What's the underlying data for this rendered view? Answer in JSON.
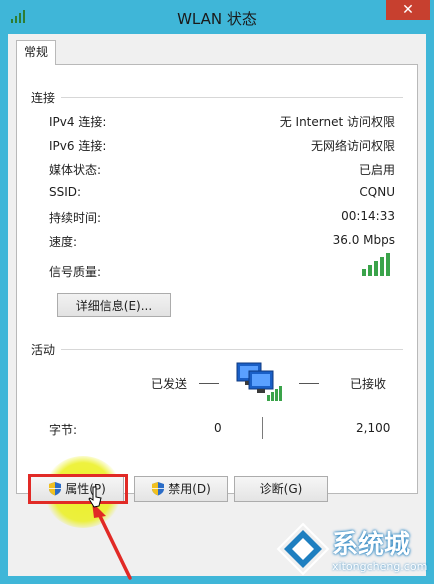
{
  "window": {
    "title": "WLAN 状态",
    "close_glyph": "✕"
  },
  "tabs": [
    {
      "label": "常规"
    }
  ],
  "connection": {
    "group_title": "连接",
    "rows": [
      {
        "label": "IPv4 连接:",
        "value": "无 Internet 访问权限"
      },
      {
        "label": "IPv6 连接:",
        "value": "无网络访问权限"
      },
      {
        "label": "媒体状态:",
        "value": "已启用"
      },
      {
        "label": "SSID:",
        "value": "CQNU"
      },
      {
        "label": "持续时间:",
        "value": "00:14:33"
      },
      {
        "label": "速度:",
        "value": "36.0 Mbps"
      }
    ],
    "signal_label": "信号质量:",
    "signal_bars": 5,
    "signal_color": "#3aa34a",
    "details_button": "详细信息(E)..."
  },
  "activity": {
    "group_title": "活动",
    "sent_label": "已发送",
    "received_label": "已接收",
    "bytes_label": "字节:",
    "bytes_sent": "0",
    "bytes_received": "2,100"
  },
  "buttons": {
    "properties": "属性(P)",
    "disable": "禁用(D)",
    "diagnose": "诊断(G)"
  },
  "watermark": {
    "text": "系统城",
    "sub": "xitongcheng.com"
  },
  "colors": {
    "frame": "#3fb6d8",
    "close": "#c7402f",
    "highlight": "#ebf01e",
    "annotation_red": "#e12a26"
  }
}
